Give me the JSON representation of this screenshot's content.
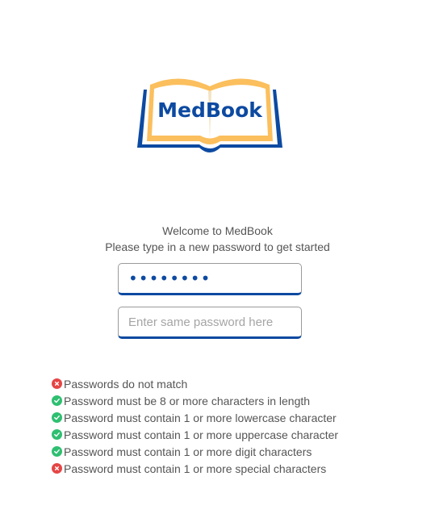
{
  "brand": {
    "name": "MedBook",
    "colors": {
      "primary": "#0d4aa1",
      "accent": "#fbbf5d",
      "pass": "#2fbf71",
      "fail": "#e64545"
    },
    "logo_icon": "open-book-icon"
  },
  "welcome": {
    "title": "Welcome to MedBook",
    "subtitle": "Please type in a new password to get started"
  },
  "form": {
    "password_value": "••••••••",
    "confirm_value": "",
    "confirm_placeholder": "Enter same password here"
  },
  "rules": [
    {
      "text": "Passwords do not match",
      "status": "fail",
      "icon": "x-circle-icon"
    },
    {
      "text": "Password must be 8 or more characters in length",
      "status": "pass",
      "icon": "check-circle-icon"
    },
    {
      "text": "Password must contain 1 or more lowercase character",
      "status": "pass",
      "icon": "check-circle-icon"
    },
    {
      "text": "Password must contain 1 or more uppercase character",
      "status": "pass",
      "icon": "check-circle-icon"
    },
    {
      "text": "Password must contain 1 or more digit characters",
      "status": "pass",
      "icon": "check-circle-icon"
    },
    {
      "text": "Password must contain 1 or more special characters",
      "status": "fail",
      "icon": "x-circle-icon"
    }
  ]
}
